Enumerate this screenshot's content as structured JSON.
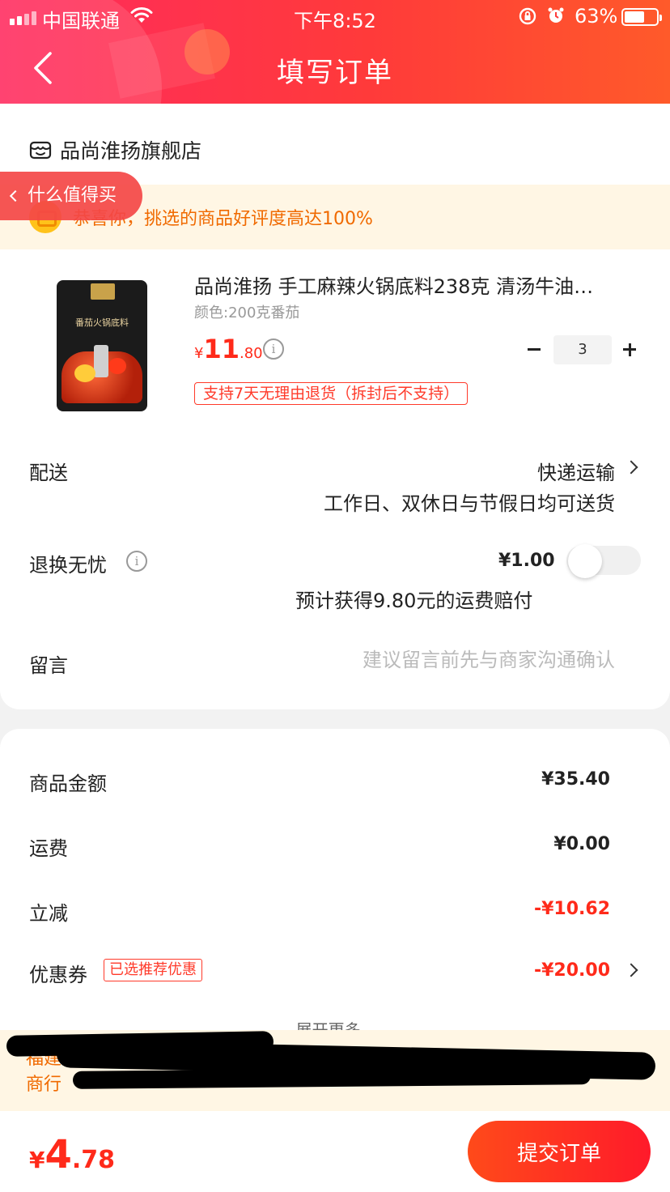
{
  "status_bar": {
    "carrier": "中国联通",
    "time": "下午8:52",
    "battery": "63%",
    "battery_level": 0.63
  },
  "header": {
    "title": "填写订单"
  },
  "store": {
    "name": "品尚淮扬旗舰店"
  },
  "floating_pill": {
    "label": "什么值得买"
  },
  "banner": {
    "text": "恭喜你，挑选的商品好评度高达100%"
  },
  "product": {
    "title": "品尚淮扬 手工麻辣火锅底料238克  清汤牛油…",
    "variant": "颜色:200克番茄",
    "price_symbol": "¥",
    "price_int": "11",
    "price_dec": ".80",
    "quantity": "3",
    "return_policy": "支持7天无理由退货（拆封后不支持）",
    "image_label": "番茄火锅底料"
  },
  "delivery": {
    "label": "配送",
    "value": "快递运输",
    "note": "工作日、双休日与节假日均可送货"
  },
  "refund": {
    "label": "退换无忧",
    "price": "¥1.00",
    "note": "预计获得9.80元的运费赔付",
    "enabled": false
  },
  "message": {
    "label": "留言",
    "placeholder": "建议留言前先与商家沟通确认"
  },
  "summary": {
    "rows": [
      {
        "label": "商品金额",
        "value": "¥35.40"
      },
      {
        "label": "运费",
        "value": "¥0.00"
      },
      {
        "label": "立减",
        "value": "-¥10.62"
      },
      {
        "label": "优惠券",
        "value": "-¥20.00"
      }
    ],
    "coupon_tag": "已选推荐优惠",
    "expand_more": "展开更多⌄"
  },
  "notice": {
    "line1_start": "福建",
    "line2_start": "商行"
  },
  "footer": {
    "total_symbol": "¥",
    "total_int": "4",
    "total_dec": ".78",
    "submit": "提交订单"
  },
  "colors": {
    "accent": "#ff2a1a",
    "header_start": "#ff2a5e",
    "header_end": "#ff5a2a",
    "banner_bg": "#fff6e4",
    "banner_text": "#f06a00"
  }
}
